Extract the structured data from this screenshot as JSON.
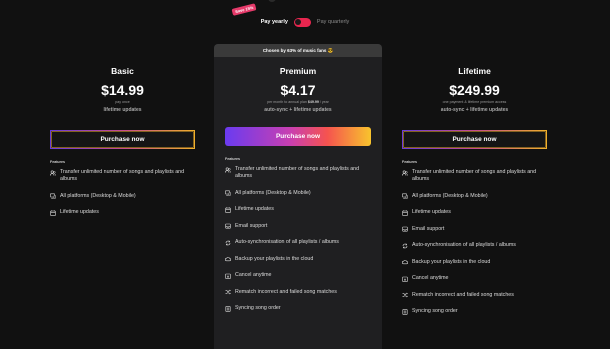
{
  "billing": {
    "promo_badge": "Save 15%",
    "yearly_label": "Pay yearly",
    "quarterly_label": "Pay quarterly"
  },
  "plans": [
    {
      "name": "Basic",
      "price": "$14.99",
      "sub": "pay once",
      "perk": "lifetime updates",
      "button": "Purchase now",
      "features_title": "Features",
      "features": [
        {
          "icon": "users-icon",
          "label": "Transfer unlimited number of songs and playlists and albums"
        },
        {
          "icon": "devices-icon",
          "label": "All platforms (Desktop & Mobile)"
        },
        {
          "icon": "calendar-icon",
          "label": "Lifetime updates"
        }
      ]
    },
    {
      "chosen_banner": "Chosen by 63% of music fans 😎",
      "name": "Premium",
      "price": "$4.17",
      "sub_prefix": "per month to annual plan ",
      "sub_bold": "$49.99",
      "sub_suffix": " / year",
      "perk": "auto-sync + lifetime updates",
      "button": "Purchase now",
      "features_title": "Features",
      "features": [
        {
          "icon": "users-icon",
          "label": "Transfer unlimited number of songs and playlists and albums"
        },
        {
          "icon": "devices-icon",
          "label": "All platforms (Desktop & Mobile)"
        },
        {
          "icon": "calendar-icon",
          "label": "Lifetime updates"
        },
        {
          "icon": "inbox-icon",
          "label": "Email support"
        },
        {
          "icon": "sync-icon",
          "label": "Auto-synchronisation of all playlists / albums"
        },
        {
          "icon": "cloud-icon",
          "label": "Backup your playlists in the cloud"
        },
        {
          "icon": "calendar-x-icon",
          "label": "Cancel anytime"
        },
        {
          "icon": "shuffle-icon",
          "label": "Rematch incorrect and failed song matches"
        },
        {
          "icon": "list-icon",
          "label": "Syncing song order"
        }
      ]
    },
    {
      "name": "Lifetime",
      "price": "$249.99",
      "sub": "one payment & lifetime premium access",
      "perk": "auto-sync + lifetime updates",
      "button": "Purchase now",
      "features_title": "Features",
      "features": [
        {
          "icon": "users-icon",
          "label": "Transfer unlimited number of songs and playlists and albums"
        },
        {
          "icon": "devices-icon",
          "label": "All platforms (Desktop & Mobile)"
        },
        {
          "icon": "calendar-icon",
          "label": "Lifetime updates"
        },
        {
          "icon": "inbox-icon",
          "label": "Email support"
        },
        {
          "icon": "sync-icon",
          "label": "Auto-synchronisation of all playlists / albums"
        },
        {
          "icon": "cloud-icon",
          "label": "Backup your playlists in the cloud"
        },
        {
          "icon": "calendar-x-icon",
          "label": "Cancel anytime"
        },
        {
          "icon": "shuffle-icon",
          "label": "Rematch incorrect and failed song matches"
        },
        {
          "icon": "list-icon",
          "label": "Syncing song order"
        }
      ]
    }
  ],
  "colors": {
    "background": "#111111",
    "card": "#1f1f21",
    "toggle": "#e8264f",
    "gradient_start": "#6a3bf0",
    "gradient_end": "#f8c42d"
  }
}
